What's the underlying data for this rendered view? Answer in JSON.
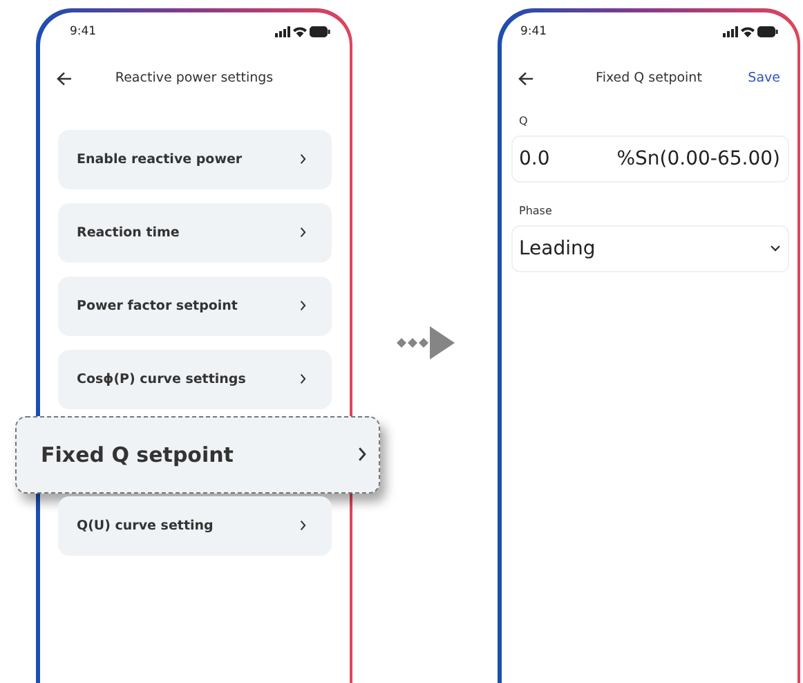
{
  "left_phone": {
    "status_time": "9:41",
    "title": "Reactive power  settings",
    "items": [
      {
        "label": "Enable reactive power",
        "highlighted": false
      },
      {
        "label": "Reaction time",
        "highlighted": false
      },
      {
        "label": "Power factor setpoint",
        "highlighted": false
      },
      {
        "label": "Cosϕ(P) curve settings",
        "highlighted": false
      },
      {
        "label": "Fixed Q setpoint",
        "highlighted": true
      },
      {
        "label": "Q(U) curve setting",
        "highlighted": false
      }
    ]
  },
  "right_phone": {
    "status_time": "9:41",
    "title": "Fixed Q setpoint",
    "action": "Save",
    "fields": [
      {
        "kind": "input",
        "label": "Q",
        "value": "0.0",
        "unit": "%Sn(0.00-65.00)"
      },
      {
        "kind": "select",
        "label": "Phase",
        "value": "Leading"
      }
    ]
  }
}
